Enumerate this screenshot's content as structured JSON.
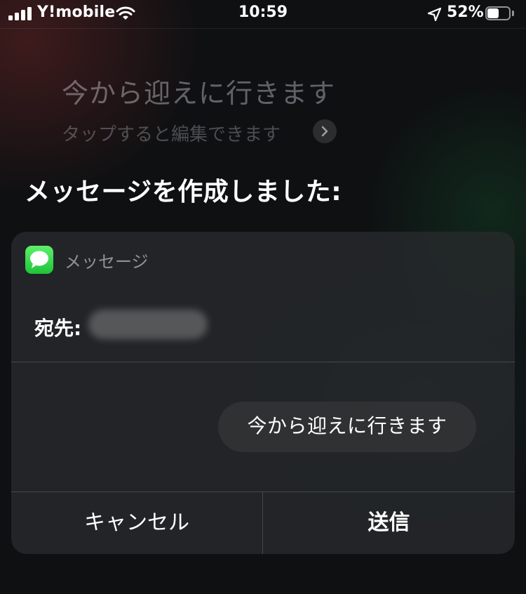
{
  "status_bar": {
    "carrier": "Y!mobile",
    "time": "10:59",
    "battery_percent_label": "52%",
    "battery_level": 0.52,
    "signal_bars": 4,
    "icons": [
      "signal-icon",
      "wifi-icon",
      "location-arrow-icon",
      "battery-icon"
    ]
  },
  "siri": {
    "query": "今から迎えに行きます",
    "edit_hint": "タップすると編集できます",
    "response_title": "メッセージを作成しました:"
  },
  "card": {
    "app_name": "メッセージ",
    "app_icon": "messages-app-icon",
    "to_label": "宛先:",
    "message_text": "今から迎えに行きます",
    "cancel_label": "キャンセル",
    "send_label": "送信",
    "accent_color": "#34C759"
  }
}
